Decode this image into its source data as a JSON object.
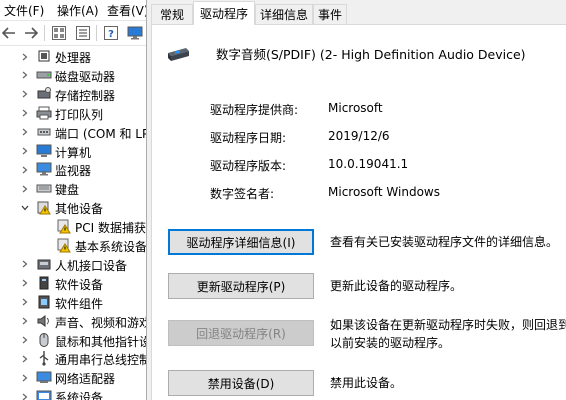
{
  "menu": {
    "file": "文件(F)",
    "action": "操作(A)",
    "view": "查看(V)"
  },
  "toolbar": {
    "back_icon": "arrow-left-icon",
    "forward_icon": "arrow-right-icon",
    "grid_icon": "properties-grid-icon",
    "list_icon": "list-icon",
    "help_icon": "help-icon",
    "monitor_icon": "monitor-icon"
  },
  "tree": {
    "items": [
      {
        "label": "处理器",
        "icon": "processor-icon",
        "expanded": false
      },
      {
        "label": "磁盘驱动器",
        "icon": "disk-drive-icon",
        "expanded": false
      },
      {
        "label": "存储控制器",
        "icon": "storage-controller-icon",
        "expanded": false
      },
      {
        "label": "打印队列",
        "icon": "printer-icon",
        "expanded": false
      },
      {
        "label": "端口 (COM 和 LPT)",
        "icon": "port-icon",
        "expanded": false
      },
      {
        "label": "计算机",
        "icon": "computer-icon",
        "expanded": false
      },
      {
        "label": "监视器",
        "icon": "monitor-icon",
        "expanded": false
      },
      {
        "label": "键盘",
        "icon": "keyboard-icon",
        "expanded": false
      },
      {
        "label": "其他设备",
        "icon": "other-devices-warning-icon",
        "expanded": true
      },
      {
        "label": "PCI 数据捕获和信号处理控制器",
        "icon": "warning-device-icon",
        "child": true
      },
      {
        "label": "基本系统设备",
        "icon": "warning-device-icon",
        "child": true
      },
      {
        "label": "人机接口设备",
        "icon": "hid-icon",
        "expanded": false
      },
      {
        "label": "软件设备",
        "icon": "software-device-icon",
        "expanded": false
      },
      {
        "label": "软件组件",
        "icon": "software-component-icon",
        "expanded": false
      },
      {
        "label": "声音、视频和游戏控制器",
        "icon": "sound-icon",
        "expanded": false
      },
      {
        "label": "鼠标和其他指针设备",
        "icon": "mouse-icon",
        "expanded": false
      },
      {
        "label": "通用串行总线控制器",
        "icon": "usb-icon",
        "expanded": false
      },
      {
        "label": "网络适配器",
        "icon": "network-adapter-icon",
        "expanded": false
      },
      {
        "label": "系统设备",
        "icon": "system-device-icon",
        "expanded": false
      }
    ]
  },
  "dialog": {
    "tabs": [
      "常规",
      "驱动程序",
      "详细信息",
      "事件"
    ],
    "active_tab": "驱动程序",
    "device_name": "数字音频(S/PDIF) (2- High Definition Audio Device)",
    "props": [
      {
        "label": "驱动程序提供商:",
        "value": "Microsoft"
      },
      {
        "label": "驱动程序日期:",
        "value": "2019/12/6"
      },
      {
        "label": "驱动程序版本:",
        "value": "10.0.19041.1"
      },
      {
        "label": "数字签名者:",
        "value": "Microsoft Windows"
      }
    ],
    "buttons": [
      {
        "label": "驱动程序详细信息(I)",
        "desc": [
          "查看有关已安装驱动程序文件的详细信息。"
        ],
        "state": "focused"
      },
      {
        "label": "更新驱动程序(P)",
        "desc": [
          "更新此设备的驱动程序。"
        ],
        "state": "normal"
      },
      {
        "label": "回退驱动程序(R)",
        "desc": [
          "如果该设备在更新驱动程序时失败，则回退到",
          "以前安装的驱动程序。"
        ],
        "state": "disabled"
      },
      {
        "label": "禁用设备(D)",
        "desc": [
          "禁用此设备。"
        ],
        "state": "normal"
      }
    ]
  }
}
